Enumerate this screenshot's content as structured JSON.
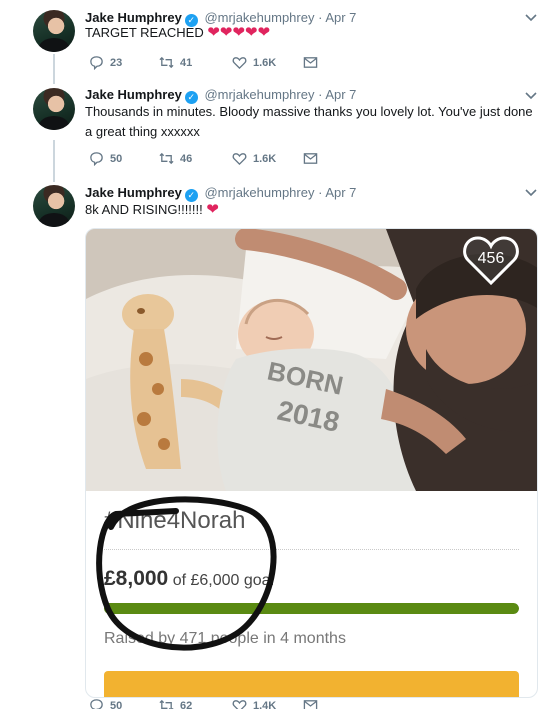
{
  "tweets": [
    {
      "name": "Jake Humphrey",
      "handle": "@mrjakehumphrey",
      "separator": "·",
      "date": "Apr 7",
      "text": "TARGET REACHED",
      "hearts": "❤❤❤❤❤",
      "replies": "23",
      "retweets": "41",
      "likes": "1.6K"
    },
    {
      "name": "Jake Humphrey",
      "handle": "@mrjakehumphrey",
      "separator": "·",
      "date": "Apr 7",
      "text": "Thousands in minutes. Bloody massive thanks you lovely lot. You've just done a great thing xxxxxx",
      "replies": "50",
      "retweets": "46",
      "likes": "1.6K"
    },
    {
      "name": "Jake Humphrey",
      "handle": "@mrjakehumphrey",
      "separator": "·",
      "date": "Apr 7",
      "text": "8k AND RISING!!!!!!!",
      "hearts": "❤",
      "replies": "50",
      "retweets": "62",
      "likes": "1.4K"
    }
  ],
  "card": {
    "like_count": "456",
    "onesie_text_1": "BORN",
    "onesie_text_2": "2018",
    "fund_title": "#Nine4Norah",
    "raised_amount": "£8,000",
    "goal_text": "of £6,000 goal",
    "progress": 1.0,
    "raised_text": "Raised by 471 people in 4 months"
  },
  "colors": {
    "verified": "#1da1f2",
    "heart": "#e0245e",
    "progress": "#5a8a12",
    "donate": "#f2b230",
    "muted": "#657786"
  }
}
